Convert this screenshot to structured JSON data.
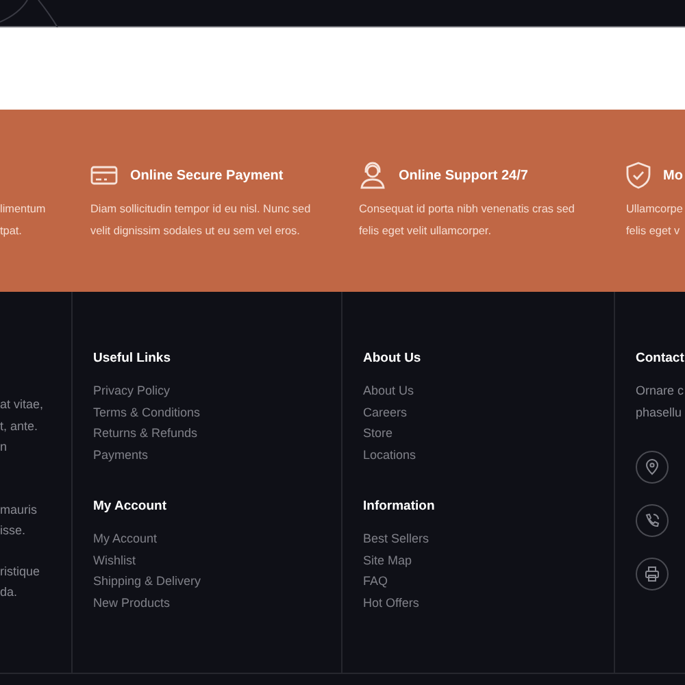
{
  "features_left_fragment": {
    "lines": [
      "limentum",
      "tpat."
    ]
  },
  "features": [
    {
      "kind": "card",
      "title": "Online Secure Payment",
      "lines": [
        "Diam sollicitudin tempor id eu nisl. Nunc sed",
        "velit dignissim sodales ut eu sem vel eros."
      ]
    },
    {
      "kind": "headset",
      "title": "Online Support 24/7",
      "lines": [
        "Consequat id porta nibh venenatis cras sed",
        "felis eget velit ullamcorper."
      ]
    },
    {
      "kind": "shield",
      "title": "Mo",
      "lines": [
        "Ullamcorpe",
        "felis eget v"
      ]
    }
  ],
  "footer_left_fragment": {
    "paragraphs": [
      [
        "at vitae,",
        "t, ante.",
        "n"
      ],
      [
        "mauris",
        "isse."
      ],
      [
        "ristique",
        "da."
      ]
    ]
  },
  "link_columns": [
    {
      "groups": [
        {
          "heading": "Useful Links",
          "links": [
            "Privacy Policy",
            "Terms & Conditions",
            "Returns & Refunds",
            "Payments"
          ]
        },
        {
          "heading": "My Account",
          "links": [
            "My Account",
            "Wishlist",
            "Shipping & Delivery",
            "New Products"
          ]
        }
      ]
    },
    {
      "groups": [
        {
          "heading": "About Us",
          "links": [
            "About Us",
            "Careers",
            "Store",
            "Locations"
          ]
        },
        {
          "heading": "Information",
          "links": [
            "Best Sellers",
            "Site Map",
            "FAQ",
            "Hot Offers"
          ]
        }
      ]
    }
  ],
  "contact": {
    "heading": "Contact",
    "lines": [
      "Ornare c",
      "phasellu"
    ],
    "items": [
      {
        "kind": "pin"
      },
      {
        "kind": "phone"
      },
      {
        "kind": "printer"
      }
    ]
  }
}
